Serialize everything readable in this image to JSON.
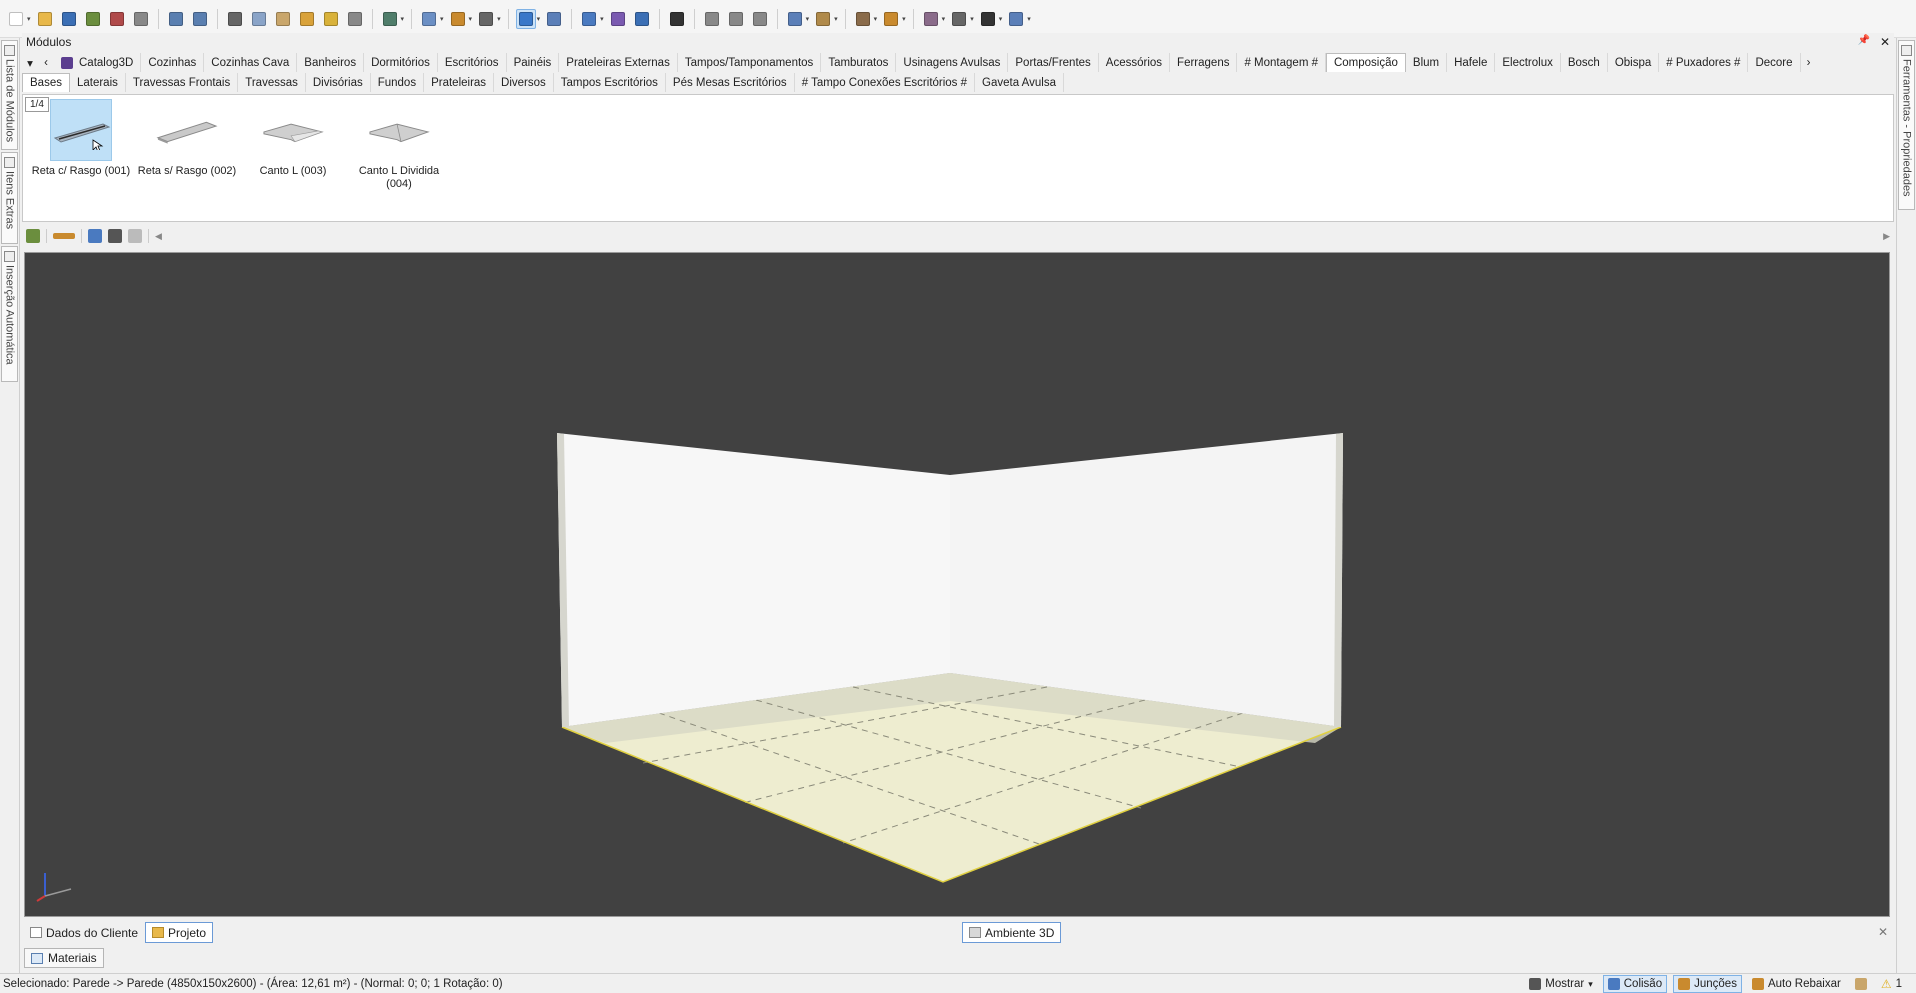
{
  "panel": {
    "title": "Módulos",
    "pin_glyph": "📌",
    "close_glyph": "✕"
  },
  "toolbar": {
    "icons": [
      {
        "name": "new-file-icon",
        "color": "#ffffff",
        "drop": true
      },
      {
        "name": "open-folder-icon",
        "color": "#e8b84a"
      },
      {
        "name": "save-icon",
        "color": "#3b6fb5"
      },
      {
        "name": "render-icon",
        "color": "#6b8e3e"
      },
      {
        "name": "render-alt-icon",
        "color": "#b04a4a"
      },
      {
        "name": "print-icon",
        "color": "#888888"
      },
      {
        "sep": true
      },
      {
        "name": "undo-icon",
        "color": "#5a7fb0"
      },
      {
        "name": "redo-icon",
        "color": "#5a7fb0"
      },
      {
        "sep": true
      },
      {
        "name": "cut-icon",
        "color": "#666666"
      },
      {
        "name": "copy-icon",
        "color": "#8aa4c8"
      },
      {
        "name": "paste-icon",
        "color": "#c9a66b"
      },
      {
        "name": "paint-brush-icon",
        "color": "#d9a23a"
      },
      {
        "name": "format-painter-icon",
        "color": "#d9b23a"
      },
      {
        "name": "delete-icon",
        "color": "#888888"
      },
      {
        "sep": true
      },
      {
        "name": "layers-icon",
        "color": "#4f7d6a",
        "drop": true
      },
      {
        "sep": true
      },
      {
        "name": "group-icon",
        "color": "#6b8fc4",
        "drop": true
      },
      {
        "name": "align-icon",
        "color": "#c98a2e",
        "drop": true
      },
      {
        "name": "shape-icon",
        "color": "#666666",
        "drop": true
      },
      {
        "sep": true
      },
      {
        "name": "select-cursor-icon",
        "color": "#3a78c9",
        "drop": true,
        "selected": true
      },
      {
        "name": "measure-icon",
        "color": "#5b7fb8"
      },
      {
        "sep": true
      },
      {
        "name": "shield-icon",
        "color": "#4a7ac0",
        "drop": true
      },
      {
        "name": "dimension-icon",
        "color": "#7a5ab0"
      },
      {
        "name": "view-3d-icon",
        "color": "#3b6fb5"
      },
      {
        "sep": true
      },
      {
        "name": "eye-icon",
        "color": "#333333"
      },
      {
        "sep": true
      },
      {
        "name": "rotate-icon",
        "color": "#888888"
      },
      {
        "name": "arrow-left-icon",
        "color": "#888888"
      },
      {
        "name": "arrow-right-icon",
        "color": "#888888"
      },
      {
        "sep": true
      },
      {
        "name": "window-icon",
        "color": "#5b7fb8",
        "drop": true
      },
      {
        "name": "box-icon",
        "color": "#b08a4a",
        "drop": true
      },
      {
        "sep": true
      },
      {
        "name": "tools-icon",
        "color": "#8a6b4a",
        "drop": true
      },
      {
        "name": "pen-icon",
        "color": "#c98a2e",
        "drop": true
      },
      {
        "sep": true
      },
      {
        "name": "report-icon",
        "color": "#8a6b8a",
        "drop": true
      },
      {
        "name": "list-icon",
        "color": "#666666",
        "drop": true
      },
      {
        "name": "cnc-icon",
        "color": "#333333",
        "drop": true
      },
      {
        "name": "export-icon",
        "color": "#5b7fb8",
        "drop": true
      }
    ]
  },
  "side_tabs": {
    "left": [
      "Lista de Módulos",
      "Itens Extras",
      "Inserção Automática"
    ],
    "right": [
      "Ferramentas - Propriedades"
    ]
  },
  "catalog_tabs": {
    "nav_down": "▾",
    "nav_prev": "‹",
    "nav_next": "›",
    "items": [
      "Catalog3D",
      "Cozinhas",
      "Cozinhas Cava",
      "Banheiros",
      "Dormitórios",
      "Escritórios",
      "Painéis",
      "Prateleiras Externas",
      "Tampos/Tamponamentos",
      "Tamburatos",
      "Usinagens Avulsas",
      "Portas/Frentes",
      "Acessórios",
      "Ferragens",
      "# Montagem #",
      "Composição",
      "Blum",
      "Hafele",
      "Electrolux",
      "Bosch",
      "Obispa",
      "# Puxadores #",
      "Decore"
    ],
    "active": 15
  },
  "sub_tabs": {
    "items": [
      "Bases",
      "Laterais",
      "Travessas Frontais",
      "Travessas",
      "Divisórias",
      "Fundos",
      "Prateleiras",
      "Diversos",
      "Tampos Escritórios",
      "Pés Mesas Escritórios",
      "# Tampo Conexões Escritórios #",
      "Gaveta Avulsa"
    ],
    "active": 0
  },
  "catalog": {
    "page": "1/4",
    "items": [
      {
        "label": "Reta c/ Rasgo (001)",
        "selected": true
      },
      {
        "label": "Reta s/ Rasgo (002)",
        "selected": false
      },
      {
        "label": "Canto L (003)",
        "selected": false
      },
      {
        "label": "Canto L Dividida (004)",
        "selected": false
      }
    ]
  },
  "mini_toolbar": {
    "icons": [
      "import-icon",
      "line-style-icon",
      "insert-icon",
      "binoculars-icon",
      "building-icon"
    ],
    "scroll_left": "◀",
    "scroll_right": "▶"
  },
  "doc_tabs": {
    "client": "Dados do Cliente",
    "project": "Projeto",
    "env": "Ambiente 3D",
    "close_glyph": "✕"
  },
  "bottom_panel": {
    "materials": "Materiais"
  },
  "status": {
    "text": "Selecionado: Parede -> Parede (4850x150x2600) - (Área: 12,61 m²) - (Normal: 0; 0; 1 Rotação: 0)",
    "show": "Mostrar",
    "show_drop": "▾",
    "collision": "Colisão",
    "joints": "Junções",
    "auto_lower": "Auto Rebaixar",
    "warnings": "1",
    "colors": {
      "collision": "#4a7ac0",
      "joints": "#c98a2e",
      "warning": "#e0b020"
    }
  }
}
